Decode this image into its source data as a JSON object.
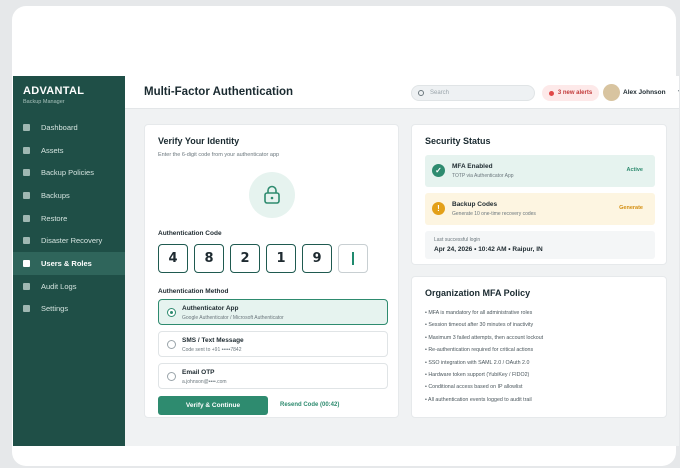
{
  "app": {
    "brand": "ADVANTAL",
    "brand_sub": "Backup Manager"
  },
  "sidebar": {
    "items": [
      {
        "label": "Dashboard",
        "active": false
      },
      {
        "label": "Assets",
        "active": false
      },
      {
        "label": "Backup Policies",
        "active": false
      },
      {
        "label": "Backups",
        "active": false
      },
      {
        "label": "Restore",
        "active": false
      },
      {
        "label": "Disaster Recovery",
        "active": false
      },
      {
        "label": "Users & Roles",
        "active": true
      },
      {
        "label": "Audit Logs",
        "active": false
      },
      {
        "label": "Settings",
        "active": false
      }
    ]
  },
  "header": {
    "title": "Multi-Factor Authentication",
    "search_placeholder": "Search",
    "alerts": "3 new alerts",
    "user_name": "Alex Johnson",
    "user_chevron": "▾"
  },
  "verify": {
    "title": "Verify Your Identity",
    "subtitle": "Enter the 6-digit code from your authenticator app",
    "code_label": "Authentication Code",
    "code_digits": [
      "4",
      "8",
      "2",
      "1",
      "9",
      ""
    ],
    "method_label": "Authentication Method",
    "methods": [
      {
        "title": "Authenticator App",
        "sub": "Google Authenticator / Microsoft Authenticator",
        "selected": true
      },
      {
        "title": "SMS / Text Message",
        "sub": "Code sent to +91 •••••7842",
        "selected": false
      },
      {
        "title": "Email OTP",
        "sub": "a.johnson@••••.com",
        "selected": false
      }
    ],
    "submit_label": "Verify & Continue",
    "resend_label": "Resend Code (00:42)"
  },
  "status": {
    "title": "Security Status",
    "mfa": {
      "title": "MFA Enabled",
      "sub": "TOTP via Authenticator App",
      "badge": "Active"
    },
    "backup": {
      "title": "Backup Codes",
      "sub": "Generate 10 one-time recovery codes",
      "badge": "Generate"
    },
    "login_label": "Last successful login",
    "login_value": "Apr 24, 2026 • 10:42 AM • Raipur, IN"
  },
  "policy": {
    "title": "Organization MFA Policy",
    "items": [
      "• MFA is mandatory for all administrative roles",
      "• Session timeout after 30 minutes of inactivity",
      "• Maximum 3 failed attempts, then account lockout",
      "• Re-authentication required for critical actions",
      "• SSO integration with SAML 2.0 / OAuth 2.0",
      "• Hardware token support (YubiKey / FIDO2)",
      "• Conditional access based on IP allowlist",
      "• All authentication events logged to audit trail"
    ]
  },
  "colors": {
    "sidebar": "#1f4f47",
    "accent": "#2e8b6f",
    "alert": "#e04848",
    "warning": "#e3a019"
  }
}
